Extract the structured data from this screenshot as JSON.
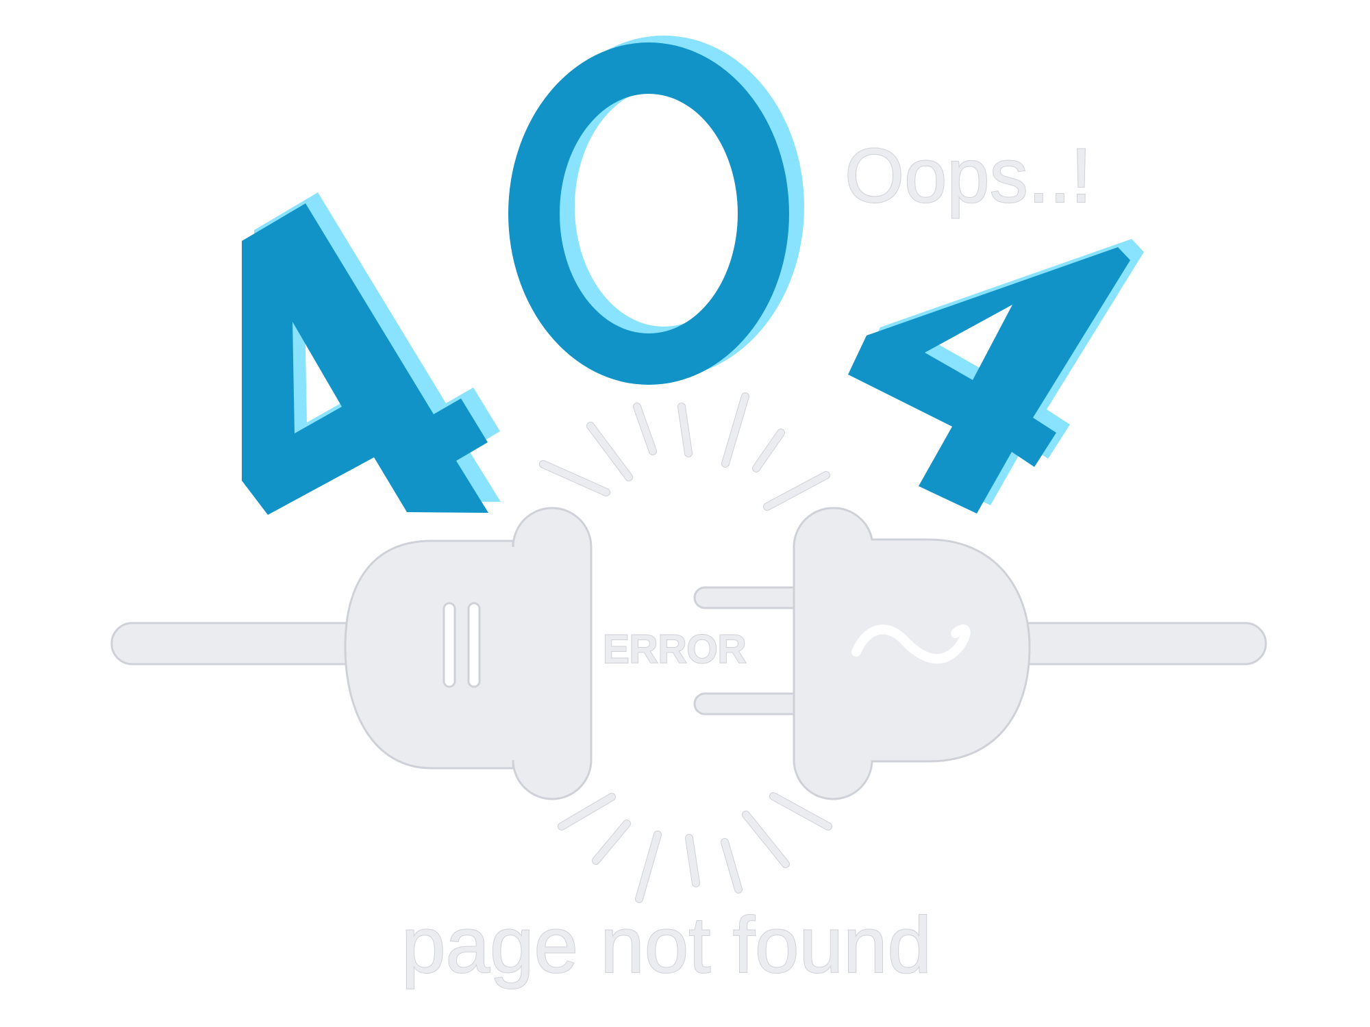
{
  "error_page": {
    "code_digits": [
      "4",
      "0",
      "4"
    ],
    "exclamation": "Oops..!",
    "plug_label": "ERROR",
    "message": "page not found"
  },
  "icons": {
    "left_plug": "plug-socket-icon",
    "right_plug": "electric-plug-icon",
    "sparks": "spark-lines-icon"
  },
  "colors": {
    "digit_primary": "#1193c8",
    "digit_shadow": "#89e3ff",
    "plug_gray": "#ebecf0",
    "background": "#ffffff"
  }
}
